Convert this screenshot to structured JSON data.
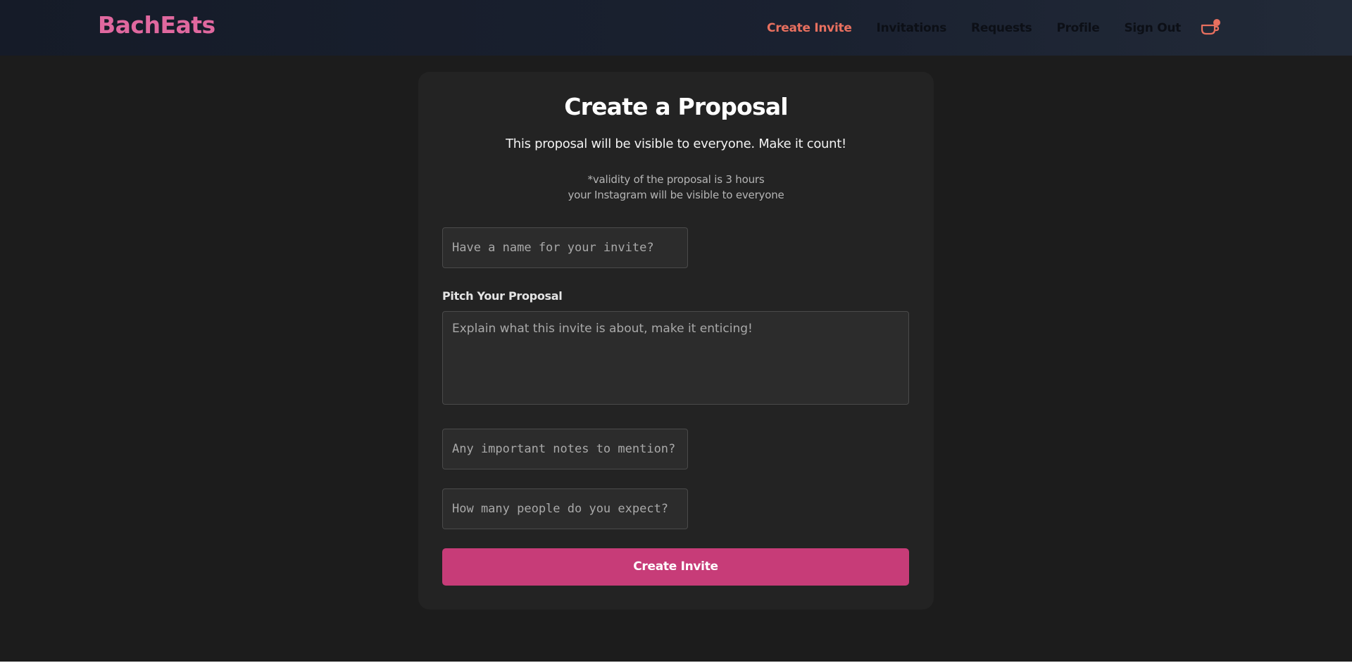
{
  "navbar": {
    "brand": "BachEats",
    "links": [
      {
        "label": "Create Invite",
        "active": true
      },
      {
        "label": "Invitations",
        "active": false
      },
      {
        "label": "Requests",
        "active": false
      },
      {
        "label": "Profile",
        "active": false
      },
      {
        "label": "Sign Out",
        "active": false
      }
    ],
    "icon": "coffee-cup-icon",
    "colors": {
      "brand": "#e0689f",
      "active_link": "#e8705f",
      "link": "#0c0f16"
    }
  },
  "form": {
    "title": "Create a Proposal",
    "subtitle": "This proposal will be visible to everyone. Make it count!",
    "note_lines": [
      "*validity of the proposal is 3 hours",
      "your Instagram will be visible to everyone"
    ],
    "name_placeholder": "Have a name for your invite?",
    "pitch_label": "Pitch Your Proposal",
    "pitch_placeholder": "Explain what this invite is about, make it enticing!",
    "notes_placeholder": "Any important notes to mention?",
    "people_placeholder": "How many people do you expect?",
    "submit_label": "Create Invite",
    "colors": {
      "submit": "#c73c78",
      "card": "#232323",
      "background": "#1c1c1c"
    }
  }
}
